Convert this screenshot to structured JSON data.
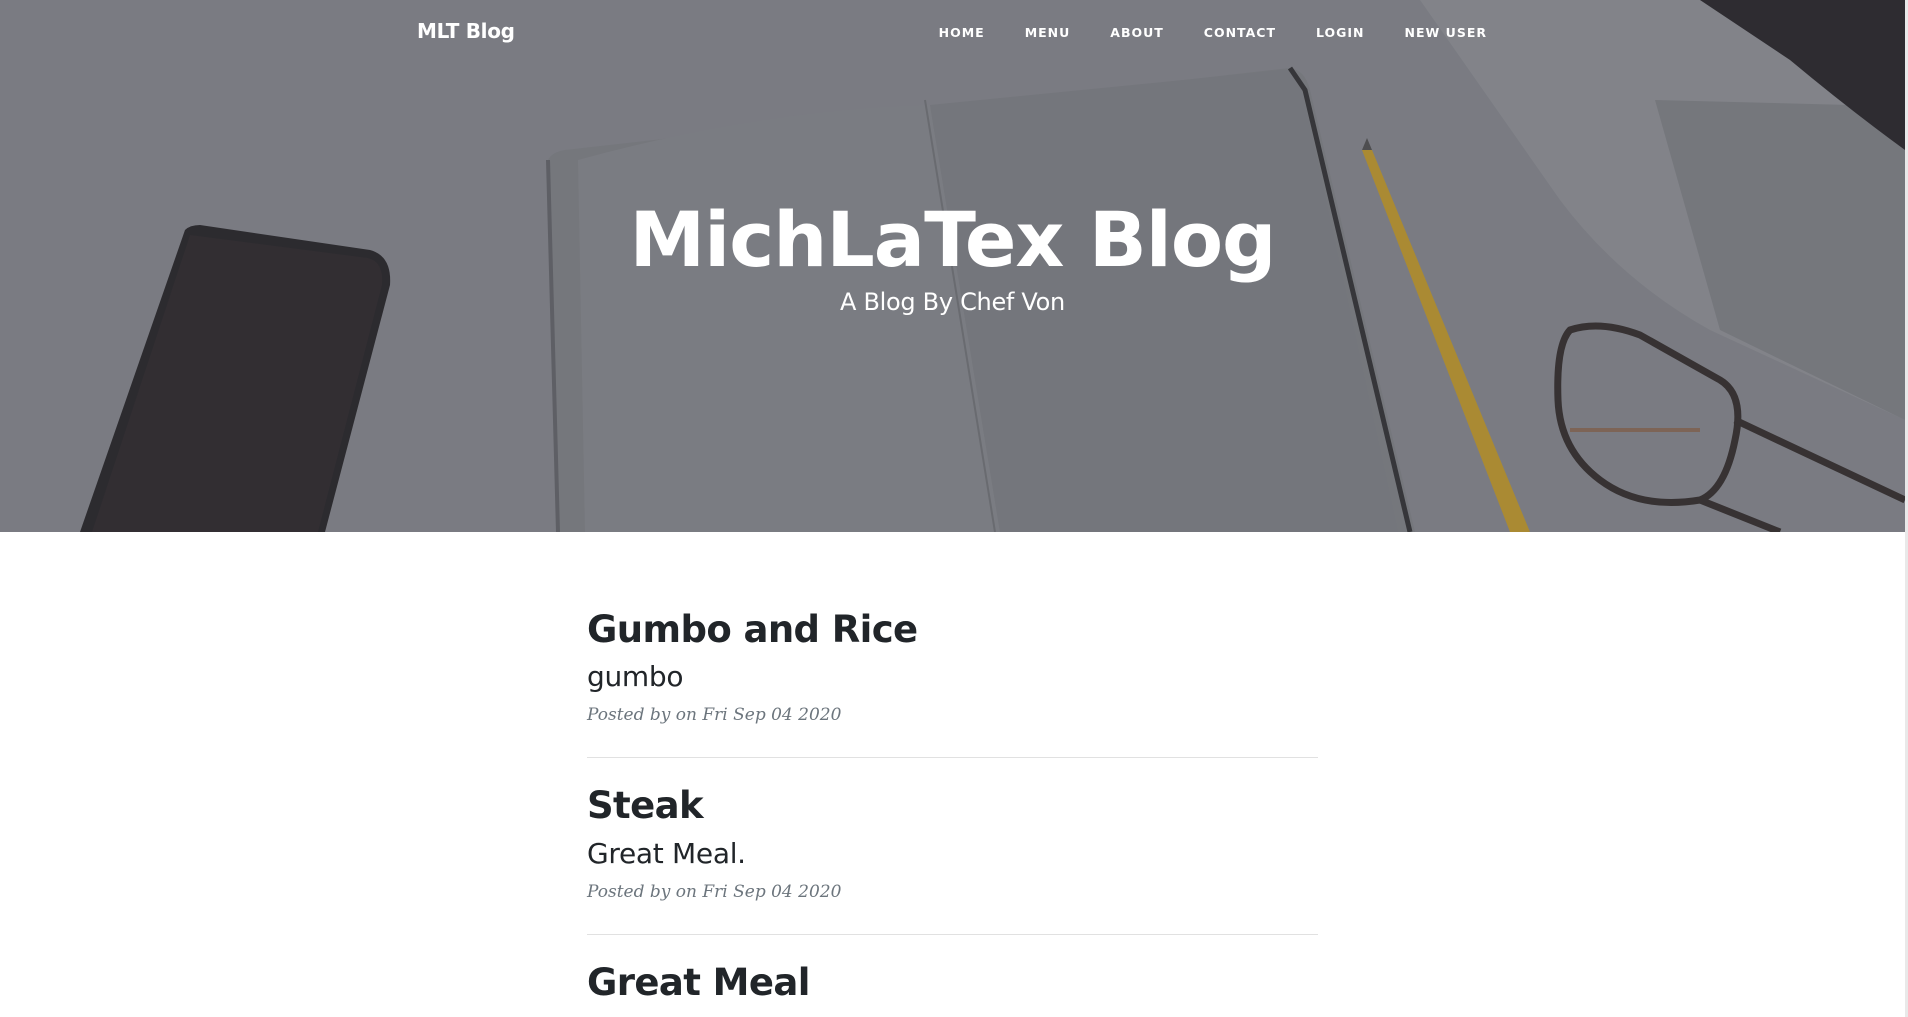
{
  "navbar": {
    "brand": "MLT Blog",
    "links": [
      "HOME",
      "MENU",
      "ABOUT",
      "CONTACT",
      "LOGIN",
      "NEW USER"
    ]
  },
  "hero": {
    "title": "MichLaTex Blog",
    "subtitle": "A Blog By Chef Von"
  },
  "posts": [
    {
      "title": "Gumbo and Rice",
      "subtitle": "gumbo",
      "meta": "Posted by on Fri Sep 04 2020"
    },
    {
      "title": "Steak",
      "subtitle": "Great Meal.",
      "meta": "Posted by on Fri Sep 04 2020"
    },
    {
      "title": "Great Meal"
    }
  ],
  "colors": {
    "hero_overlay": "#83868c",
    "text_dark": "#212529",
    "meta_gray": "#6c757d",
    "divider": "#e1e1e1"
  }
}
